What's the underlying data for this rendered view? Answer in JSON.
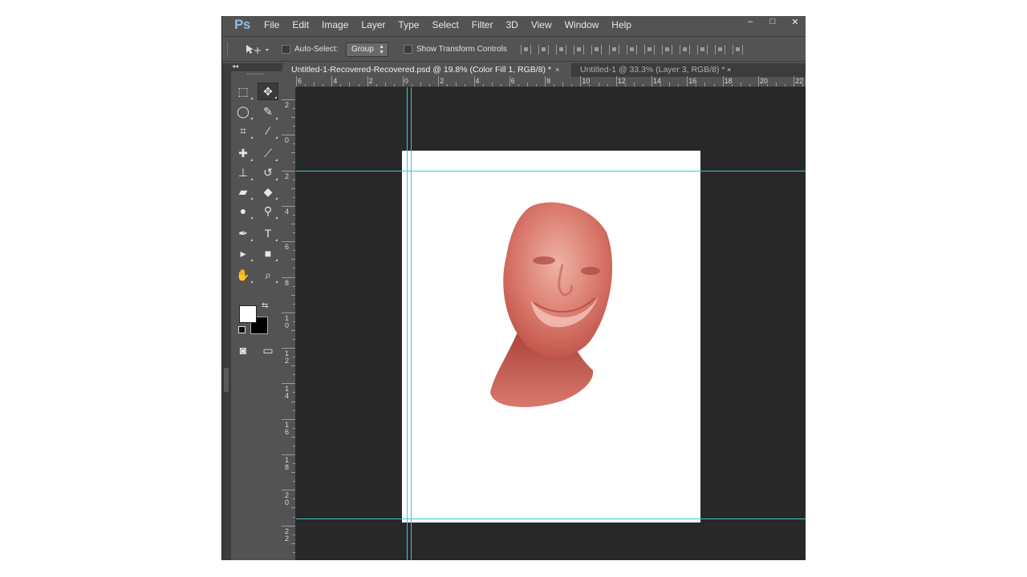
{
  "app": {
    "logo": "Ps",
    "menu": [
      "File",
      "Edit",
      "Image",
      "Layer",
      "Type",
      "Select",
      "Filter",
      "3D",
      "View",
      "Window",
      "Help"
    ],
    "window_controls": {
      "minimize": "–",
      "maximize": "□",
      "close": "✕"
    }
  },
  "options_bar": {
    "auto_select_label": "Auto-Select:",
    "auto_select_checked": false,
    "auto_select_target": "Group",
    "transform_controls_label": "Show Transform Controls",
    "transform_controls_checked": false
  },
  "tabs": [
    {
      "label": "Untitled-1-Recovered-Recovered.psd @ 19.8% (Color Fill 1, RGB/8) *",
      "active": true,
      "close": "×"
    },
    {
      "label": "Untitled-1 @ 33.3% (Layer 3, RGB/8) *",
      "active": false,
      "close": "×"
    }
  ],
  "rulers": {
    "horizontal_labels": [
      "6",
      "4",
      "2",
      "0",
      "2",
      "4",
      "6",
      "8",
      "10",
      "12",
      "14",
      "16",
      "18",
      "20",
      "22"
    ],
    "vertical_labels": [
      "2",
      "0",
      "2",
      "4",
      "6",
      "8",
      "10",
      "12",
      "14",
      "16",
      "18",
      "20",
      "22"
    ]
  },
  "toolbox": {
    "collapse": "◂◂",
    "tools": [
      {
        "name": "rectangular-marquee-tool",
        "icon": "⬚"
      },
      {
        "name": "move-tool",
        "icon": "✥",
        "selected": true
      },
      {
        "name": "lasso-tool",
        "icon": "◯"
      },
      {
        "name": "quick-selection-tool",
        "icon": "✎"
      },
      {
        "name": "crop-tool",
        "icon": "⌗"
      },
      {
        "name": "eyedropper-tool",
        "icon": "⁄"
      },
      {
        "name": "spot-healing-brush-tool",
        "icon": "✚"
      },
      {
        "name": "brush-tool",
        "icon": "⟋"
      },
      {
        "name": "clone-stamp-tool",
        "icon": "⊥"
      },
      {
        "name": "history-brush-tool",
        "icon": "↺"
      },
      {
        "name": "eraser-tool",
        "icon": "▰"
      },
      {
        "name": "paint-bucket-tool",
        "icon": "◆"
      },
      {
        "name": "blur-tool",
        "icon": "●"
      },
      {
        "name": "dodge-tool",
        "icon": "⚲"
      },
      {
        "name": "pen-tool",
        "icon": "✒"
      },
      {
        "name": "type-tool",
        "icon": "T"
      },
      {
        "name": "path-selection-tool",
        "icon": "▸"
      },
      {
        "name": "rectangle-tool",
        "icon": "■"
      },
      {
        "name": "hand-tool",
        "icon": "✋"
      },
      {
        "name": "zoom-tool",
        "icon": "⌕"
      },
      {
        "name": "quick-mask-mode",
        "icon": "◙"
      },
      {
        "name": "screen-mode",
        "icon": "▭"
      }
    ],
    "foreground_color": "#ffffff",
    "background_color": "#000000",
    "swap_icon": "⇆"
  },
  "canvas": {
    "pasteboard_color": "#282828",
    "document_color": "#ffffff",
    "guide_color": "#37c8d8",
    "artwork": "painted-face-head"
  }
}
